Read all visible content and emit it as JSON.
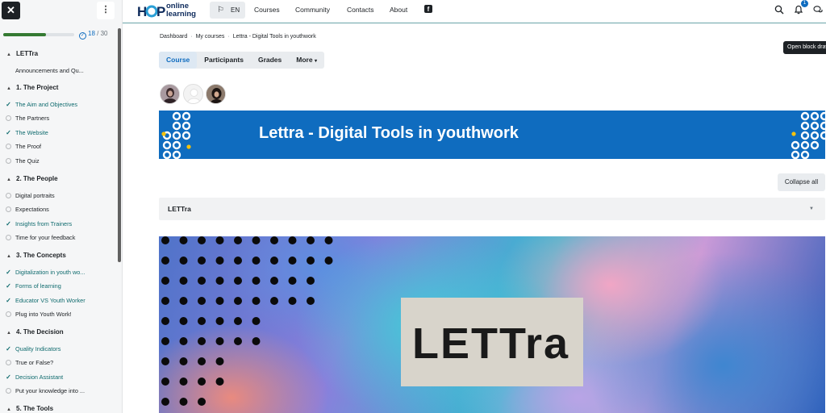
{
  "sidebar": {
    "close_icon": "close-icon",
    "menu_icon": "kebab-menu-icon",
    "progress": {
      "completed": "18",
      "total": "/ 30",
      "fraction": 0.6
    },
    "sections": [
      {
        "title": "LETTra",
        "items": [
          {
            "label": "Announcements and Qu...",
            "status": "none"
          }
        ]
      },
      {
        "title": "1. The Project",
        "items": [
          {
            "label": "The Aim and Objectives",
            "status": "done"
          },
          {
            "label": "The Partners",
            "status": "todo"
          },
          {
            "label": "The Website",
            "status": "done"
          },
          {
            "label": "The Proof",
            "status": "todo"
          },
          {
            "label": "The Quiz",
            "status": "todo"
          }
        ]
      },
      {
        "title": "2. The People",
        "items": [
          {
            "label": "Digital portraits",
            "status": "todo"
          },
          {
            "label": "Expectations",
            "status": "todo"
          },
          {
            "label": "Insights from Trainers",
            "status": "done"
          },
          {
            "label": "Time for your feedback",
            "status": "todo"
          }
        ]
      },
      {
        "title": "3. The Concepts",
        "items": [
          {
            "label": "Digitalization in youth wo...",
            "status": "done"
          },
          {
            "label": "Forms of learning",
            "status": "done"
          },
          {
            "label": "Educator VS Youth Worker",
            "status": "done"
          },
          {
            "label": "Plug into Youth Work!",
            "status": "todo"
          }
        ]
      },
      {
        "title": "4. The Decision",
        "items": [
          {
            "label": "Quality Indicators",
            "status": "done"
          },
          {
            "label": "True or False?",
            "status": "todo"
          },
          {
            "label": "Decision Assistant",
            "status": "done"
          },
          {
            "label": "Put your knowledge into ...",
            "status": "todo"
          }
        ]
      },
      {
        "title": "5. The Tools",
        "items": []
      }
    ]
  },
  "header": {
    "logo": {
      "mark": "HOP",
      "line1": "online",
      "line2": "learning"
    },
    "language": "EN",
    "nav": [
      "Courses",
      "Community",
      "Contacts",
      "About"
    ],
    "social_icon": "facebook-icon",
    "notification_count": "1",
    "colors": {
      "accent": "#0f6cbf",
      "border": "#6aa4a8"
    }
  },
  "breadcrumb": {
    "items": [
      "Dashboard",
      "My courses",
      "Lettra - Digital Tools in youthwork"
    ],
    "separator": "·"
  },
  "tabs": {
    "items": [
      "Course",
      "Participants",
      "Grades",
      "More"
    ],
    "active": "Course"
  },
  "tooltip": "Open block drawer",
  "banner": {
    "title": "Lettra - Digital Tools in youthwork"
  },
  "collapse_label": "Collapse all",
  "section": {
    "title": "LETTra"
  },
  "hero": {
    "text": "LETTra"
  }
}
